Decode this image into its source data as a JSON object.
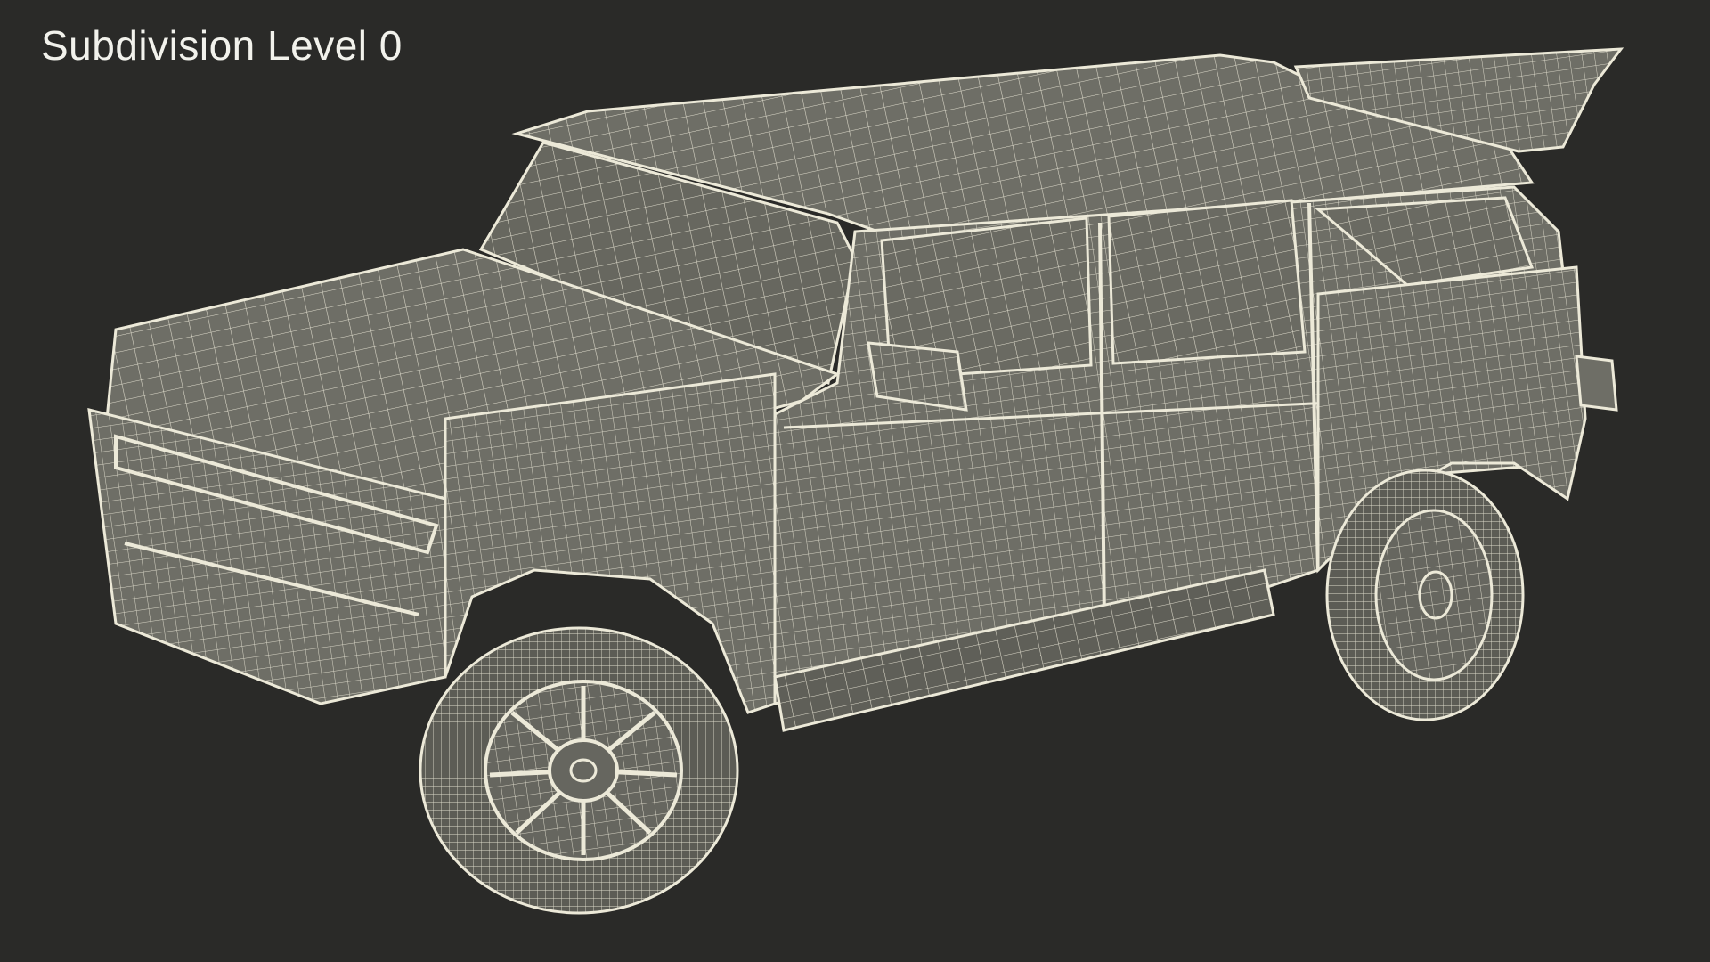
{
  "overlay": {
    "subdivision_label": "Subdivision Level 0"
  },
  "render": {
    "subject": "wireframe-suv",
    "background_color": "#2a2a28",
    "surface_color": "#6e6e66",
    "wire_color": "#ece9d8"
  }
}
